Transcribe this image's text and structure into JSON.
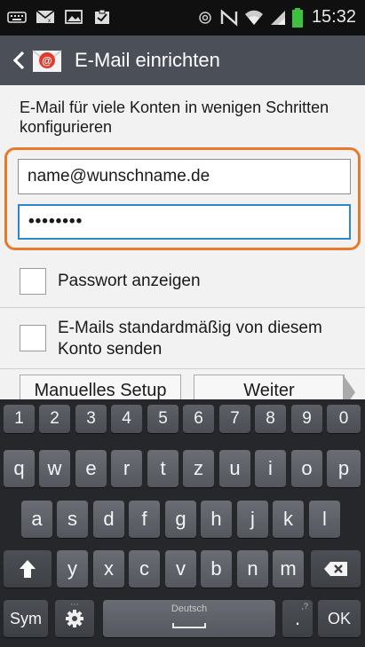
{
  "status_bar": {
    "time": "15:32",
    "left_icons": [
      "keyboard-icon",
      "mail-icon",
      "image-icon",
      "clipboard-check-icon"
    ],
    "right_icons": [
      "vibrate-icon",
      "nfc-icon",
      "wifi-icon",
      "signal-icon",
      "battery-icon"
    ]
  },
  "action_bar": {
    "title": "E-Mail einrichten",
    "back_icon": "chevron-left-icon",
    "app_icon": "email-app-icon"
  },
  "form": {
    "intro": "E-Mail für viele Konten in wenigen Schritten konfigurieren",
    "email_value": "name@wunschname.de",
    "password_value": "••••••••",
    "highlight_color": "#e9792a",
    "focus_color": "#2d87c8"
  },
  "options": {
    "show_password": "Passwort anzeigen",
    "default_send": "E-Mails standardmäßig von diesem Konto senden"
  },
  "buttons": {
    "manual": "Manuelles Setup",
    "next": "Weiter"
  },
  "keyboard": {
    "numbers": [
      "1",
      "2",
      "3",
      "4",
      "5",
      "6",
      "7",
      "8",
      "9",
      "0"
    ],
    "row1": [
      "q",
      "w",
      "e",
      "r",
      "t",
      "z",
      "u",
      "i",
      "o",
      "p"
    ],
    "row2": [
      "a",
      "s",
      "d",
      "f",
      "g",
      "h",
      "j",
      "k",
      "l"
    ],
    "row3": [
      "y",
      "x",
      "c",
      "v",
      "b",
      "n",
      "m"
    ],
    "sym": "Sym",
    "space_label": "Deutsch",
    "period": ".",
    "period_sup": ",?",
    "ok": "OK"
  }
}
